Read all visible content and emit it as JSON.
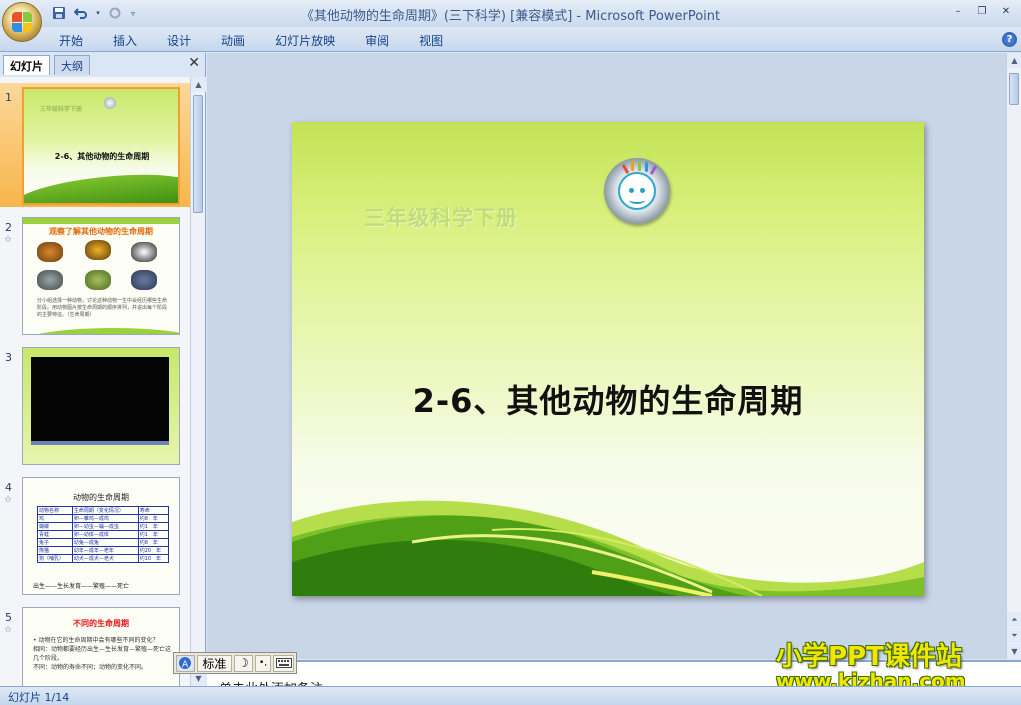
{
  "window": {
    "title": "《其他动物的生命周期》(三下科学) [兼容模式] - Microsoft PowerPoint",
    "minimize": "–",
    "restore": "❐",
    "close": "✕"
  },
  "qat": {
    "save_icon": "save-icon",
    "undo_icon": "undo-icon",
    "redo_icon": "redo-icon",
    "customize_icon": "customize-icon"
  },
  "ribbon": {
    "tabs": [
      "开始",
      "插入",
      "设计",
      "动画",
      "幻灯片放映",
      "审阅",
      "视图"
    ],
    "help": "?"
  },
  "left_pane": {
    "tab_slides": "幻灯片",
    "tab_outline": "大纲",
    "close": "✕"
  },
  "thumbnails": [
    {
      "num": "1",
      "subtitle": "三年级科学下册",
      "title": "2-6、其他动物的生命周期"
    },
    {
      "num": "2",
      "anim": "☆",
      "title": "观察了解其他动物的生命周期",
      "text": "分小组选择一种动物，讨论这种动物一生中会经历哪些生命阶段。用动物图片按生命周期的顺序排列，并说出每个阶段的主要特征。（生命周期）"
    },
    {
      "num": "3"
    },
    {
      "num": "4",
      "anim": "☆",
      "title": "动物的生命周期",
      "table": [
        [
          "动物名称",
          "生命周期（变化情况）",
          "寿命"
        ],
        [
          "鸡",
          "卵—雏鸡—成鸡",
          "约8　年"
        ],
        [
          "蝴蝶",
          "卵—幼虫—蛹—成虫",
          "约1　年"
        ],
        [
          "青蛙",
          "卵—幼体—成体",
          "约1　年"
        ],
        [
          "兔子",
          "幼兔—成兔",
          "约8　年"
        ],
        [
          "熊猫",
          "幼年—成年—老年",
          "约20　年"
        ],
        [
          "狗（哺乳）",
          "幼犬—成犬—老犬",
          "约10　年"
        ]
      ],
      "foot": "出生——生长发育——繁殖——死亡"
    },
    {
      "num": "5",
      "anim": "☆",
      "title": "不同的生命周期",
      "text": [
        "• 动物在它的生命周期中会有哪些不同的变化？",
        "相同：动物都要经历出生—生长发育—繁殖—死亡这几个阶段。",
        "不同：动物的寿命不同；动物的变化不同。"
      ]
    }
  ],
  "slide": {
    "subtitle": "三年级科学下册",
    "title": "2-6、其他动物的生命周期",
    "logo_icon": "smiley-logo-icon"
  },
  "notes": {
    "placeholder": "单击此处添加备注"
  },
  "ime": {
    "icon": "ime-logo-icon",
    "mode": "标准",
    "moon": "☽",
    "punct": "•,",
    "keyboard": "keyboard-icon"
  },
  "watermark": {
    "line1": "小学PPT课件站",
    "line2": "www.kjzhan.com"
  },
  "status": {
    "slide_counter": "幻灯片 1/14"
  },
  "colors": {
    "office_blue": "#15428b",
    "selection_orange": "#f7b64c",
    "slide_green": "#7ac02c"
  }
}
